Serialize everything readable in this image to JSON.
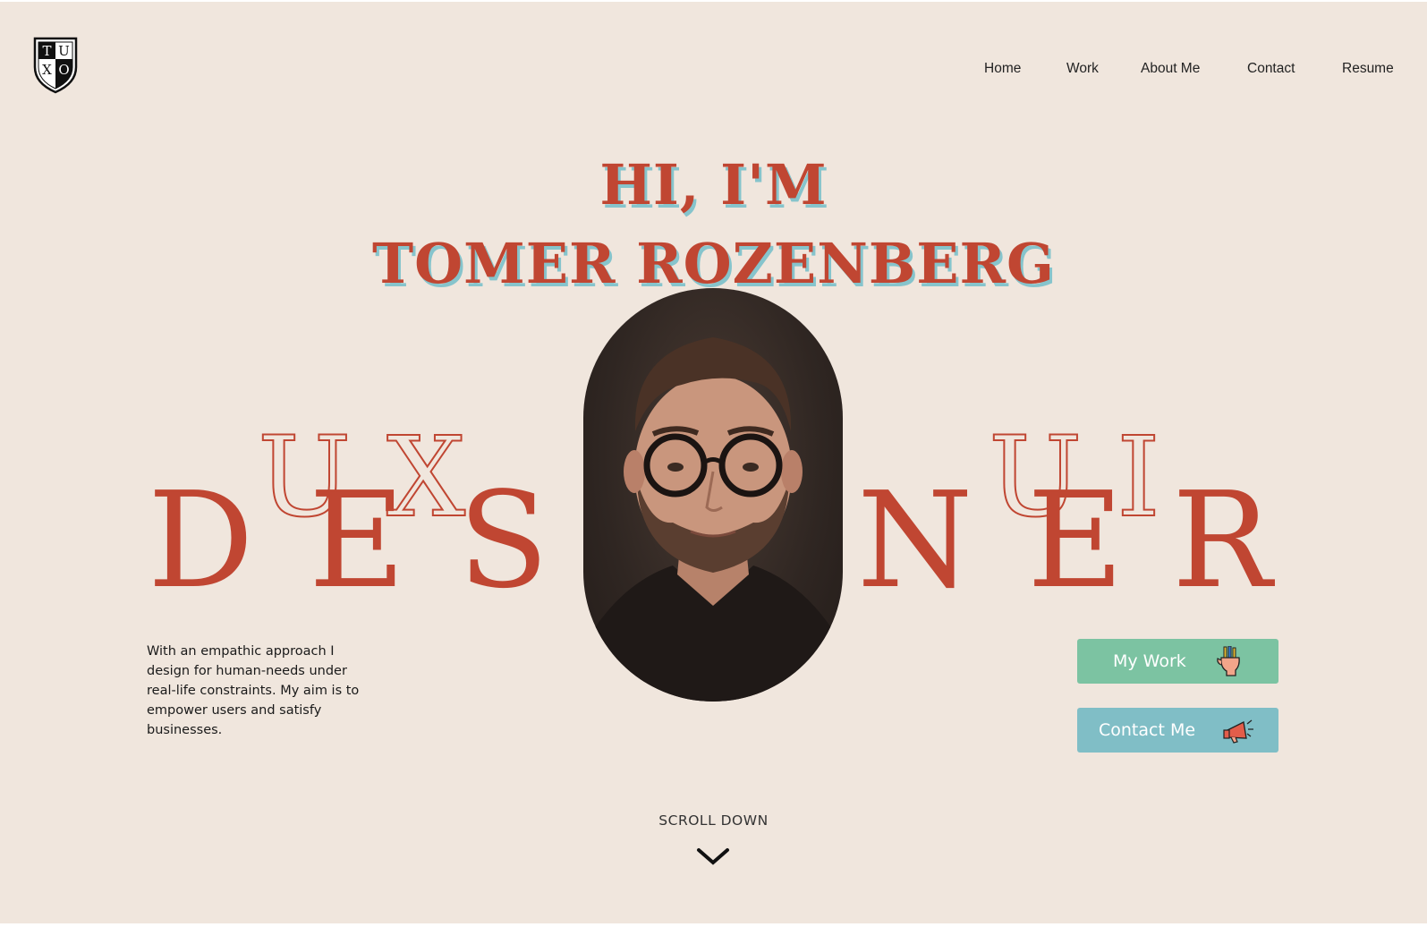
{
  "logo": {
    "letters": [
      "T",
      "U",
      "X",
      "O"
    ]
  },
  "nav": {
    "items": [
      {
        "label": "Home"
      },
      {
        "label": "Work"
      },
      {
        "label": "About Me"
      },
      {
        "label": "Contact"
      },
      {
        "label": "Resume"
      }
    ]
  },
  "hero": {
    "line1": "HI, I'M",
    "line2": "TOMER ROZENBERG",
    "word_letters": [
      "D",
      "E",
      "S",
      "N",
      "E",
      "R"
    ],
    "outline_left": [
      "U",
      "X"
    ],
    "outline_right": [
      "U",
      "I"
    ]
  },
  "description": "With an empathic approach I design for human-needs under real-life constraints. My aim is to empower users and satisfy businesses.",
  "buttons": {
    "my_work": "My Work",
    "contact_me": "Contact Me"
  },
  "scroll": {
    "label": "SCROLL DOWN"
  },
  "colors": {
    "background": "#f0e6dd",
    "accent": "#c04632",
    "shadow": "#86c4cc",
    "work_button": "#7cc3a2",
    "contact_button": "#80bec6"
  },
  "icons": [
    "shield-logo-icon",
    "hand-pencils-icon",
    "megaphone-icon",
    "chevron-down-icon"
  ]
}
